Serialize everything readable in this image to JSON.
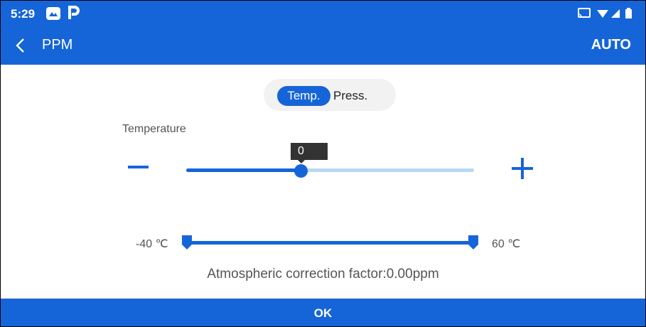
{
  "status_bar": {
    "time": "5:29",
    "notification_icons": [
      "gallery-icon",
      "parking-icon"
    ],
    "system_icons": [
      "cast-icon",
      "wifi-icon",
      "signal-icon",
      "battery-icon"
    ]
  },
  "app_bar": {
    "title": "PPM",
    "action_label": "AUTO"
  },
  "mode_toggle": {
    "options": [
      "Temp.",
      "Press."
    ],
    "selected": "Temp."
  },
  "temperature": {
    "label": "Temperature",
    "value": "0",
    "slider_fraction": 0.4,
    "range_min_label": "-40 ℃",
    "range_max_label": "60 ℃"
  },
  "correction": {
    "text": "Atmospheric correction factor:0.00ppm"
  },
  "ok_label": "OK",
  "colors": {
    "primary": "#1565d8",
    "track_light": "#b9d8f3",
    "tooltip": "#333333"
  }
}
